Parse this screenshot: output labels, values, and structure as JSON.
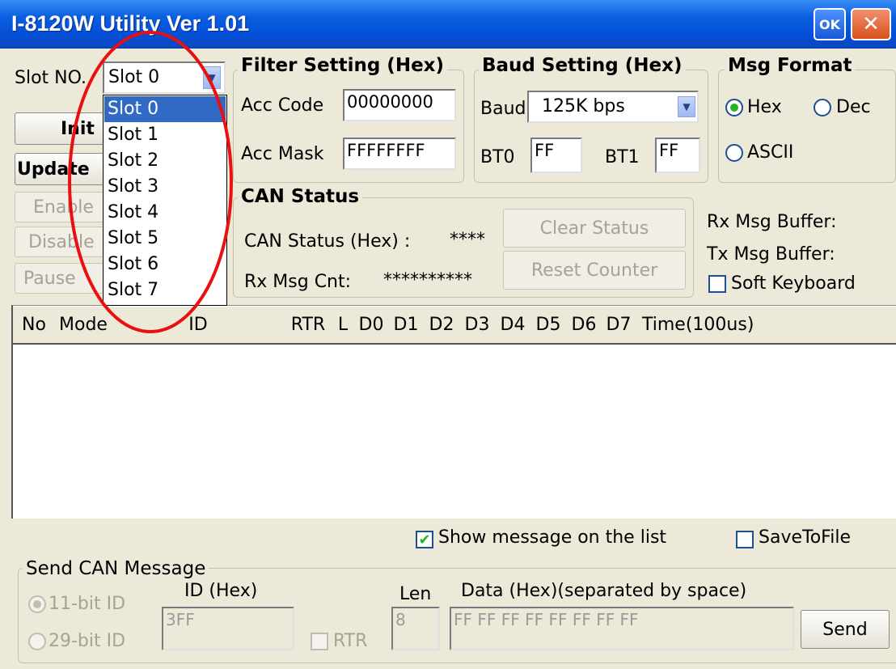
{
  "window": {
    "title": "I-8120W Utility Ver 1.01",
    "ok_label": "OK",
    "close_glyph": "✕"
  },
  "slot": {
    "label": "Slot NO.",
    "selected": "Slot 0",
    "options": [
      "Slot 0",
      "Slot 1",
      "Slot 2",
      "Slot 3",
      "Slot 4",
      "Slot 5",
      "Slot 6",
      "Slot 7"
    ],
    "highlighted_index": 0
  },
  "left_buttons": {
    "init": "Init",
    "update": "Update",
    "enable": "Enable",
    "disable": "Disable",
    "pause": "Pause"
  },
  "filter": {
    "title": "Filter Setting (Hex)",
    "acc_code_label": "Acc Code",
    "acc_code": "00000000",
    "acc_mask_label": "Acc Mask",
    "acc_mask": "FFFFFFFF"
  },
  "baud": {
    "title": "Baud Setting (Hex)",
    "baud_label": "Baud",
    "baud_value": "125K bps",
    "bt0_label": "BT0",
    "bt0": "FF",
    "bt1_label": "BT1",
    "bt1": "FF"
  },
  "msg_format": {
    "title": "Msg Format",
    "hex": "Hex",
    "dec": "Dec",
    "ascii": "ASCII",
    "selected": "Hex"
  },
  "can_status": {
    "title": "CAN Status",
    "status_label": "CAN Status (Hex) :",
    "status_value": "****",
    "rx_cnt_label": "Rx Msg Cnt:",
    "rx_cnt_value": "**********",
    "clear_button": "Clear Status",
    "reset_button": "Reset Counter"
  },
  "buffers": {
    "rx": "Rx Msg Buffer:",
    "tx": "Tx Msg Buffer:",
    "soft_keyboard": "Soft Keyboard"
  },
  "list": {
    "columns": [
      "No",
      "Mode",
      "ID",
      "RTR",
      "L",
      "D0",
      "D1",
      "D2",
      "D3",
      "D4",
      "D5",
      "D6",
      "D7",
      "Time(100us)"
    ]
  },
  "options": {
    "show_message": "Show message on the list",
    "show_message_checked": true,
    "save_to_file": "SaveToFile",
    "save_to_file_checked": false
  },
  "send": {
    "title": "Send CAN Message",
    "id11": "11-bit ID",
    "id29": "29-bit ID",
    "id_label": "ID (Hex)",
    "id_value": "3FF",
    "rtr": "RTR",
    "len_label": "Len",
    "len_value": "8",
    "data_label": "Data (Hex)(separated by space)",
    "data_value": "FF FF FF FF FF FF FF FF",
    "send_button": "Send"
  },
  "annotation": {
    "color": "#e81010",
    "shape": "red-ellipse"
  }
}
